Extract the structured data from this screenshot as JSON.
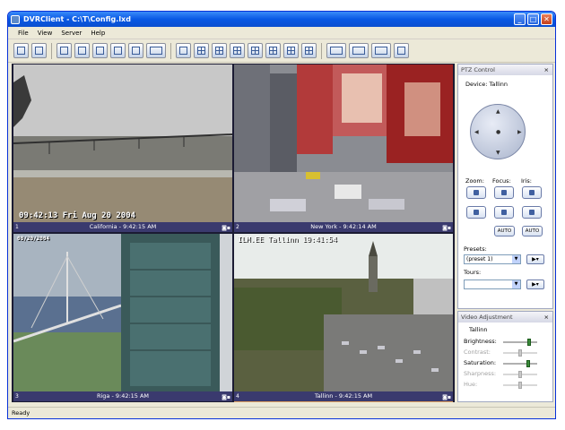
{
  "window": {
    "title": "DVRClient - C:\\T\\Config.lxd"
  },
  "menu": [
    "File",
    "View",
    "Server",
    "Help"
  ],
  "toolbar": {
    "icons": [
      "open-icon",
      "save-icon",
      "properties-icon",
      "edit-icon",
      "record-icon",
      "camera-icon",
      "fullscreen-icon",
      "print-icon",
      "layout-1-icon",
      "layout-4-icon",
      "layout-6-icon",
      "layout-9-icon",
      "layout-8-icon",
      "layout-10-icon",
      "layout-13-icon",
      "layout-16-icon",
      "export-icon",
      "ptz-icon",
      "motion-icon",
      "windows-icon"
    ]
  },
  "cameras": [
    {
      "number": "1",
      "caption": "California - 9:42:15 AM",
      "osd": "09:42:13 Fri Aug 20 2004"
    },
    {
      "number": "2",
      "caption": "New York - 9:42:14 AM",
      "osd": ""
    },
    {
      "number": "3",
      "caption": "Riga - 9:42:15 AM",
      "osd": "08/20/2004"
    },
    {
      "number": "4",
      "caption": "Tallinn - 9:42:15 AM",
      "osd": "ILM.EE Tallinn 19:41:54"
    }
  ],
  "ptz": {
    "title": "PTZ Control",
    "device_label": "Device: Tallinn",
    "zoom_label": "Zoom:",
    "focus_label": "Focus:",
    "iris_label": "Iris:",
    "auto_label": "AUTO",
    "presets_label": "Presets:",
    "preset_value": "(preset 1)",
    "tours_label": "Tours:",
    "tour_value": ""
  },
  "video_adjustment": {
    "title": "Video Adjustment",
    "camera": "Tallinn",
    "brightness_label": "Brightness:",
    "contrast_label": "Contrast:",
    "saturation_label": "Saturation:",
    "sharpness_label": "Sharpness:",
    "hue_label": "Hue:",
    "brightness": 0.8,
    "contrast": 0.5,
    "saturation": 0.75,
    "sharpness": 0.5,
    "hue": 0.5
  },
  "status": {
    "text": "Ready"
  },
  "close_glyph": "×"
}
